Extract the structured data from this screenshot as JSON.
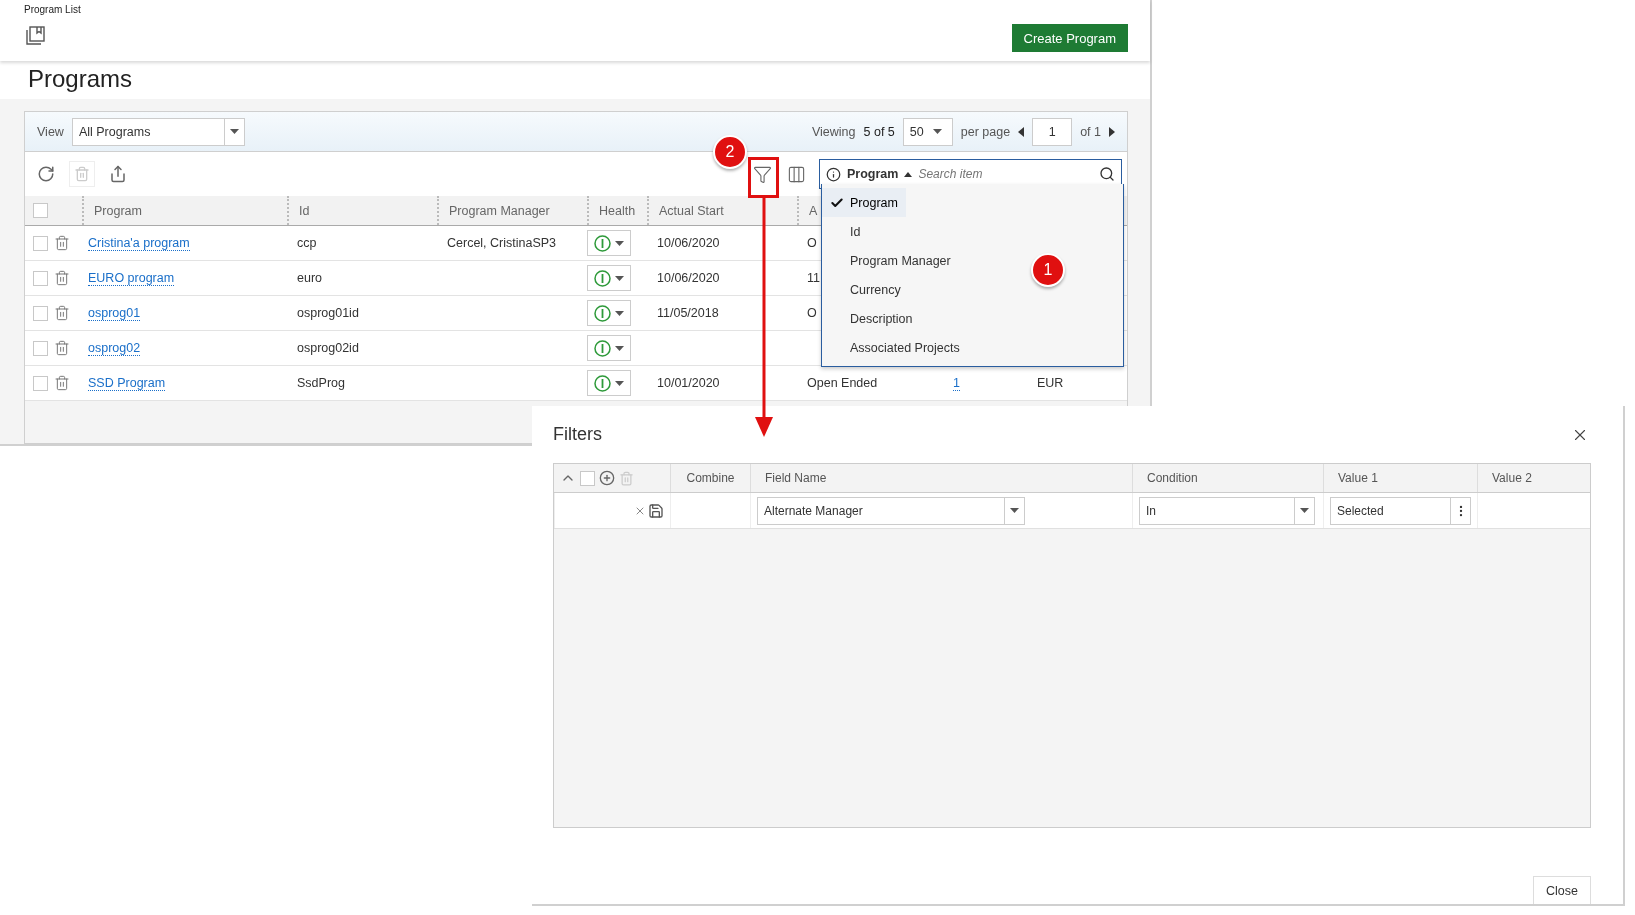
{
  "window": {
    "title": "Program List"
  },
  "create_button": "Create Program",
  "page_title": "Programs",
  "view_bar": {
    "label": "View",
    "view": "All Programs",
    "viewing_label": "Viewing",
    "viewing": "5 of 5",
    "per_page_value": "50",
    "per_page_label": "per page",
    "page": "1",
    "page_of": "of 1"
  },
  "grid": {
    "all_checked": false,
    "columns": [
      "Program",
      "Id",
      "Program Manager",
      "Health",
      "Actual Start",
      "A"
    ],
    "rows": [
      {
        "checked": false,
        "program": "Cristina'a program",
        "id": "ccp",
        "manager": "Cercel, CristinaSP3",
        "actual_start": "10/06/2020",
        "column_6": "O"
      },
      {
        "checked": false,
        "program": "EURO program",
        "id": "euro",
        "actual_start": "10/06/2020",
        "column_6": "11"
      },
      {
        "checked": false,
        "program": "osprog01",
        "id": "osprog01id",
        "actual_start": "11/05/2018",
        "column_6": "O"
      },
      {
        "checked": false,
        "program": "osprog02",
        "id": "osprog02id"
      },
      {
        "checked": false,
        "program": "SSD Program",
        "id": "SsdProg",
        "actual_start": "10/01/2020",
        "column_6": "Open Ended",
        "column_7": "1",
        "column_8": "EUR"
      }
    ]
  },
  "search_dropdown": {
    "field": "Program",
    "placeholder": "Search item",
    "items": [
      {
        "label": "Program",
        "selected": true
      },
      {
        "label": "Id",
        "selected": false
      },
      {
        "label": "Program Manager",
        "selected": false
      },
      {
        "label": "Currency",
        "selected": false
      },
      {
        "label": "Description",
        "selected": false
      },
      {
        "label": "Associated Projects",
        "selected": false
      }
    ]
  },
  "annotations": [
    {
      "label": "2"
    },
    {
      "label": "1"
    }
  ],
  "filters_dialog": {
    "title": "Filters",
    "all_checked": false,
    "columns": [
      "Combine",
      "Field Name",
      "Condition",
      "Value 1",
      "Value 2"
    ],
    "rows": [
      {
        "field_name": "Alternate Manager",
        "condition": "In",
        "value_1": "Selected"
      }
    ],
    "close_button": "Close"
  }
}
